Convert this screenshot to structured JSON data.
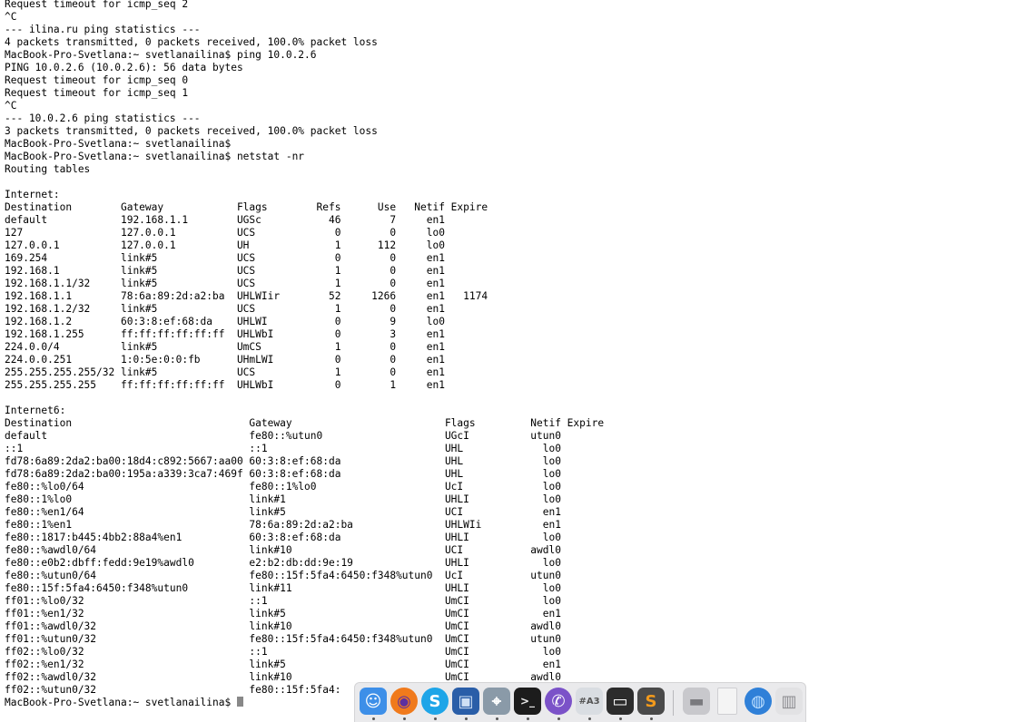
{
  "terminal": {
    "lines": [
      "Request timeout for icmp_seq 2",
      "^C",
      "--- ilina.ru ping statistics ---",
      "4 packets transmitted, 0 packets received, 100.0% packet loss",
      "MacBook-Pro-Svetlana:~ svetlanailina$ ping 10.0.2.6",
      "PING 10.0.2.6 (10.0.2.6): 56 data bytes",
      "Request timeout for icmp_seq 0",
      "Request timeout for icmp_seq 1",
      "^C",
      "--- 10.0.2.6 ping statistics ---",
      "3 packets transmitted, 0 packets received, 100.0% packet loss",
      "MacBook-Pro-Svetlana:~ svetlanailina$",
      "MacBook-Pro-Svetlana:~ svetlanailina$ netstat -nr",
      "Routing tables",
      "",
      "Internet:",
      "Destination        Gateway            Flags        Refs      Use   Netif Expire",
      "default            192.168.1.1        UGSc           46        7     en1",
      "127                127.0.0.1          UCS             0        0     lo0",
      "127.0.0.1          127.0.0.1          UH              1      112     lo0",
      "169.254            link#5             UCS             0        0     en1",
      "192.168.1          link#5             UCS             1        0     en1",
      "192.168.1.1/32     link#5             UCS             1        0     en1",
      "192.168.1.1        78:6a:89:2d:a2:ba  UHLWIir        52     1266     en1   1174",
      "192.168.1.2/32     link#5             UCS             1        0     en1",
      "192.168.1.2        60:3:8:ef:68:da    UHLWI           0        9     lo0",
      "192.168.1.255      ff:ff:ff:ff:ff:ff  UHLWbI          0        3     en1",
      "224.0.0/4          link#5             UmCS            1        0     en1",
      "224.0.0.251        1:0:5e:0:0:fb      UHmLWI          0        0     en1",
      "255.255.255.255/32 link#5             UCS             1        0     en1",
      "255.255.255.255    ff:ff:ff:ff:ff:ff  UHLWbI          0        1     en1",
      "",
      "Internet6:",
      "Destination                             Gateway                         Flags         Netif Expire",
      "default                                 fe80::%utun0                    UGcI          utun0",
      "::1                                     ::1                             UHL             lo0",
      "fd78:6a89:2da2:ba00:18d4:c892:5667:aa00 60:3:8:ef:68:da                 UHL             lo0",
      "fd78:6a89:2da2:ba00:195a:a339:3ca7:469f 60:3:8:ef:68:da                 UHL             lo0",
      "fe80::%lo0/64                           fe80::1%lo0                     UcI             lo0",
      "fe80::1%lo0                             link#1                          UHLI            lo0",
      "fe80::%en1/64                           link#5                          UCI             en1",
      "fe80::1%en1                             78:6a:89:2d:a2:ba               UHLWIi          en1",
      "fe80::1817:b445:4bb2:88a4%en1           60:3:8:ef:68:da                 UHLI            lo0",
      "fe80::%awdl0/64                         link#10                         UCI           awdl0",
      "fe80::e0b2:dbff:fedd:9e19%awdl0         e2:b2:db:dd:9e:19               UHLI            lo0",
      "fe80::%utun0/64                         fe80::15f:5fa4:6450:f348%utun0  UcI           utun0",
      "fe80::15f:5fa4:6450:f348%utun0          link#11                         UHLI            lo0",
      "ff01::%lo0/32                           ::1                             UmCI            lo0",
      "ff01::%en1/32                           link#5                          UmCI            en1",
      "ff01::%awdl0/32                         link#10                         UmCI          awdl0",
      "ff01::%utun0/32                         fe80::15f:5fa4:6450:f348%utun0  UmCI          utun0",
      "ff02::%lo0/32                           ::1                             UmCI            lo0",
      "ff02::%en1/32                           link#5                          UmCI            en1",
      "ff02::%awdl0/32                         link#10                         UmCI          awdl0",
      "ff02::%utun0/32                         fe80::15f:5fa4:",
      "MacBook-Pro-Svetlana:~ svetlanailina$ "
    ]
  },
  "dock": {
    "apps": [
      {
        "name": "finder-icon",
        "bg": "#3d8fe8",
        "glyph": "☺",
        "fg": "#ffffff",
        "running": true
      },
      {
        "name": "firefox-icon",
        "bg": "#f07a1c",
        "glyph": "◉",
        "fg": "#5b2fa0",
        "running": true
      },
      {
        "name": "skype-icon",
        "bg": "#1ea5e8",
        "glyph": "S",
        "fg": "#ffffff",
        "running": true
      },
      {
        "name": "virtualbox-icon",
        "bg": "#2a5ea8",
        "glyph": "▣",
        "fg": "#cfe0f5",
        "running": true
      },
      {
        "name": "network-utility-icon",
        "bg": "#8a9aa8",
        "glyph": "⌖",
        "fg": "#ffffff",
        "running": true
      },
      {
        "name": "terminal-icon",
        "bg": "#1c1c1c",
        "glyph": ">_",
        "fg": "#e8e8e8",
        "running": true
      },
      {
        "name": "viber-icon",
        "bg": "#7b52c8",
        "glyph": "✆",
        "fg": "#ffffff",
        "running": true
      },
      {
        "name": "color-meter-icon",
        "bg": "#d9dde2",
        "glyph": "#A3",
        "fg": "#555555",
        "running": true
      },
      {
        "name": "screenshot-icon",
        "bg": "#2c2c2c",
        "glyph": "▭",
        "fg": "#ffffff",
        "running": true
      },
      {
        "name": "sublime-text-icon",
        "bg": "#4a4a4a",
        "glyph": "S",
        "fg": "#f39a1c",
        "running": true
      },
      {
        "name": "disk-drive-icon",
        "bg": "#c8c8cc",
        "glyph": "▬",
        "fg": "#7a7a7e",
        "running": false
      },
      {
        "name": "document-icon",
        "bg": "#f4f4f4",
        "glyph": "",
        "fg": "#999999",
        "running": false
      },
      {
        "name": "network-globe-icon",
        "bg": "#2f80d8",
        "glyph": "◍",
        "fg": "#bfe0ff",
        "running": false
      },
      {
        "name": "trash-icon",
        "bg": "#e2e2e4",
        "glyph": "▥",
        "fg": "#8c8c90",
        "running": false
      }
    ]
  }
}
